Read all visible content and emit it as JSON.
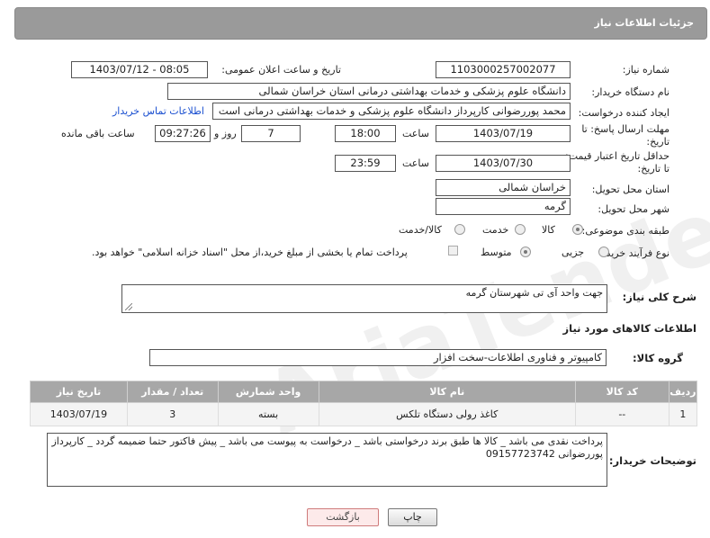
{
  "header": {
    "title": "جزئیات اطلاعات نیاز"
  },
  "fields": {
    "need_number": {
      "label": "شماره نیاز:",
      "value": "1103000257002077"
    },
    "announce_datetime": {
      "label": "تاریخ و ساعت اعلان عمومی:",
      "value": "1403/07/12 - 08:05"
    },
    "buyer_org": {
      "label": "نام دستگاه خریدار:",
      "value": "دانشگاه علوم پزشکی و خدمات بهداشتی درمانی استان خراسان شمالی"
    },
    "requester": {
      "label": "ایجاد کننده درخواست:",
      "value": "محمد پوررضوانی کارپرداز دانشگاه علوم پزشکی و خدمات بهداشتی درمانی است",
      "contact_link": "اطلاعات تماس خریدار"
    },
    "reply_deadline": {
      "label": "مهلت ارسال پاسخ: تا تاریخ:",
      "date": "1403/07/19",
      "time_label": "ساعت",
      "time": "18:00",
      "days": "7",
      "days_label": "روز و",
      "remaining": "09:27:26",
      "remaining_label": "ساعت باقی مانده"
    },
    "price_validity": {
      "label": "حداقل تاریخ اعتبار قیمت: تا تاریخ:",
      "date": "1403/07/30",
      "time_label": "ساعت",
      "time": "23:59"
    },
    "delivery_province": {
      "label": "استان محل تحویل:",
      "value": "خراسان شمالی"
    },
    "delivery_city": {
      "label": "شهر محل تحویل:",
      "value": "گرمه"
    },
    "category": {
      "label": "طبقه بندی موضوعی:",
      "options": [
        "کالا",
        "خدمت",
        "کالا/خدمت"
      ],
      "selected": "کالا"
    },
    "process_type": {
      "label": "نوع فرآیند خرید :",
      "options": [
        "جزیی",
        "متوسط"
      ],
      "selected": "متوسط",
      "note": "پرداخت تمام یا بخشی از مبلغ خرید،از محل \"اسناد خزانه اسلامی\" خواهد بود."
    }
  },
  "description": {
    "label": "شرح کلی نیاز:",
    "value": "جهت واحد آی تی شهرستان گرمه"
  },
  "goods_section": {
    "title": "اطلاعات کالاهای مورد نیاز"
  },
  "goods_group": {
    "label": "گروه کالا:",
    "value": "کامپیوتر و فناوری اطلاعات-سخت افزار"
  },
  "table": {
    "headers": [
      "ردیف",
      "کد کالا",
      "نام کالا",
      "واحد شمارش",
      "تعداد / مقدار",
      "تاریخ نیاز"
    ],
    "rows": [
      [
        "1",
        "--",
        "کاغذ رولی دستگاه تلکس",
        "بسته",
        "3",
        "1403/07/19"
      ]
    ]
  },
  "buyer_notes": {
    "label": "توضیحات خریدار:",
    "value": "پرداخت نقدی می باشد _ کالا ها طبق برند درخواستی باشد _ درخواست به پیوست می باشد _ پیش فاکتور حتما ضمیمه گردد _ کارپرداز پوررضوانی 09157723742"
  },
  "buttons": {
    "print": "چاپ",
    "back": "بازگشت"
  },
  "watermark": "AriaTender.net"
}
